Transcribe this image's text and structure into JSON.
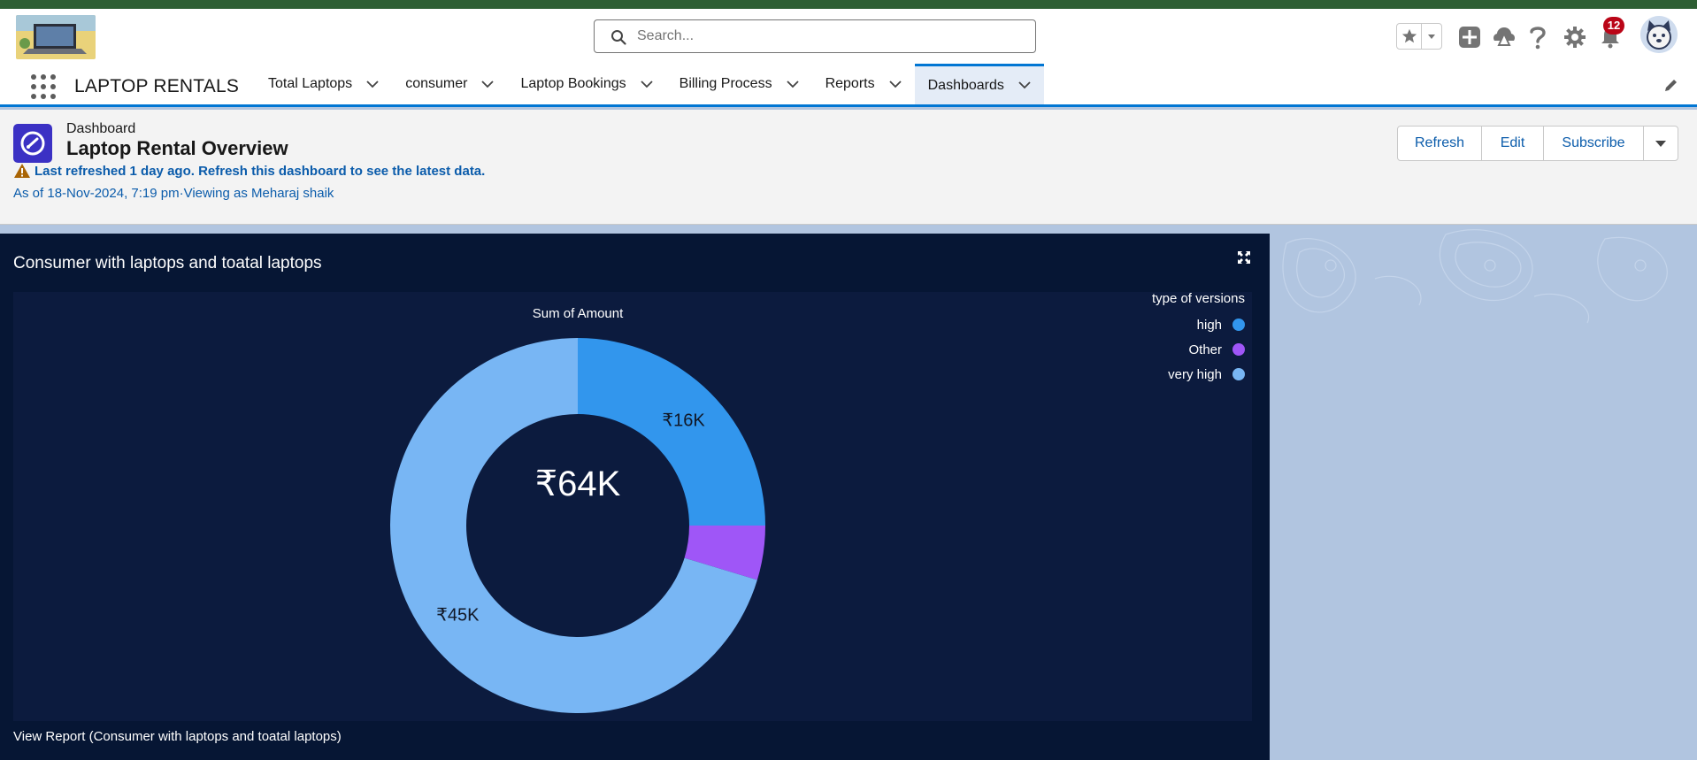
{
  "header": {
    "search_placeholder": "Search...",
    "notification_count": "12"
  },
  "nav": {
    "app_name": "LAPTOP RENTALS",
    "tabs": [
      {
        "label": "Total Laptops",
        "active": false
      },
      {
        "label": "consumer",
        "active": false
      },
      {
        "label": "Laptop Bookings",
        "active": false
      },
      {
        "label": "Billing Process",
        "active": false
      },
      {
        "label": "Reports",
        "active": false
      },
      {
        "label": "Dashboards",
        "active": true
      }
    ]
  },
  "dashboard": {
    "type_label": "Dashboard",
    "title": "Laptop Rental Overview",
    "warning": "Last refreshed 1 day ago. Refresh this dashboard to see the latest data.",
    "as_of": "As of 18-Nov-2024, 7:19 pm·Viewing as Meharaj shaik",
    "buttons": {
      "refresh": "Refresh",
      "edit": "Edit",
      "subscribe": "Subscribe"
    }
  },
  "widget": {
    "title": "Consumer with laptops and toatal laptops",
    "view_report": "View Report (Consumer with laptops and toatal laptops)"
  },
  "chart_data": {
    "type": "pie",
    "variant": "donut",
    "title": "Sum of Amount",
    "center_label": "₹64K",
    "legend_title": "type of versions",
    "legend_position": "top-right",
    "slices": [
      {
        "name": "high",
        "value": 16000,
        "label": "₹16K",
        "color": "#3296ed"
      },
      {
        "name": "Other",
        "value": 3000,
        "label": "",
        "color": "#9f56f7"
      },
      {
        "name": "very high",
        "value": 45000,
        "label": "₹45K",
        "color": "#78b6f4"
      }
    ]
  },
  "colors": {
    "brand": "#0176d3",
    "widget_bg": "#061634",
    "chart_bg": "#0c1b3e",
    "link": "#0b5cab",
    "dashboard_icon": "#3b31c4"
  }
}
